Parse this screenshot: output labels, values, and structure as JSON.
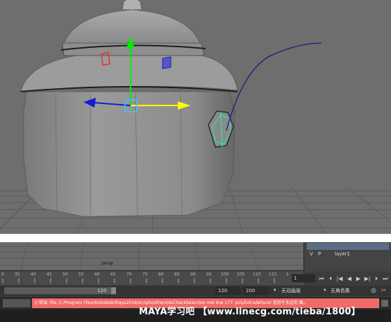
{
  "viewport_bottom": {
    "camera_label": "persp"
  },
  "layers": [
    {
      "visible": "V",
      "playback": "P",
      "name": "layer1"
    }
  ],
  "timeline": {
    "ticks": [
      "0",
      "35",
      "40",
      "45",
      "50",
      "55",
      "60",
      "65",
      "70",
      "75",
      "80",
      "85",
      "90",
      "95",
      "100",
      "105",
      "110",
      "115"
    ],
    "last_tick": "1",
    "current_frame": "1"
  },
  "range": {
    "range_end_value": "120",
    "end_time": "120",
    "anim_end": "200",
    "layer_dropdown": "无动画层",
    "character_dropdown": "无角色集"
  },
  "command": {
    "error_text": "// 错误: file: C:/Program Files/Autodesk/Maya2016/scripts/others/doCheckSelection.mel line 177: polyExtrudeFacet 适用于多边形 面。"
  },
  "watermark": "MAYA学习吧 【www.linecg.com/tieba/1800】",
  "colors": {
    "x_axis": "#ffff00",
    "y_axis": "#00ff00",
    "z_axis": "#0000ff",
    "error_bg": "#f06a6a"
  }
}
